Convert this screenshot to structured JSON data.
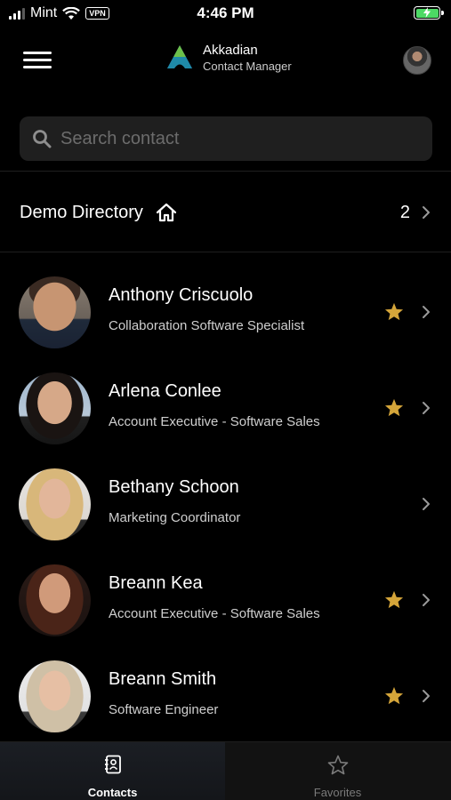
{
  "status_bar": {
    "carrier": "Mint",
    "vpn": "VPN",
    "time": "4:46 PM"
  },
  "header": {
    "app_name": "Akkadian",
    "app_subtitle": "Contact Manager"
  },
  "search": {
    "placeholder": "Search contact"
  },
  "directory": {
    "label": "Demo Directory",
    "count": "2"
  },
  "contacts": [
    {
      "name": "Anthony Criscuolo",
      "title": "Collaboration Software Specialist",
      "favorite": true
    },
    {
      "name": "Arlena Conlee",
      "title": "Account Executive - Software Sales",
      "favorite": true
    },
    {
      "name": "Bethany Schoon",
      "title": "Marketing Coordinator",
      "favorite": false
    },
    {
      "name": "Breann Kea",
      "title": "Account Executive - Software Sales",
      "favorite": true
    },
    {
      "name": "Breann Smith",
      "title": "Software Engineer",
      "favorite": true
    }
  ],
  "tabs": [
    {
      "label": "Contacts",
      "icon": "contact-card-icon",
      "active": true
    },
    {
      "label": "Favorites",
      "icon": "star-outline-icon",
      "active": false
    }
  ],
  "colors": {
    "background": "#000000",
    "star": "#d4a53a",
    "battery": "#4cd964",
    "search_bg": "#1f1f1f"
  }
}
